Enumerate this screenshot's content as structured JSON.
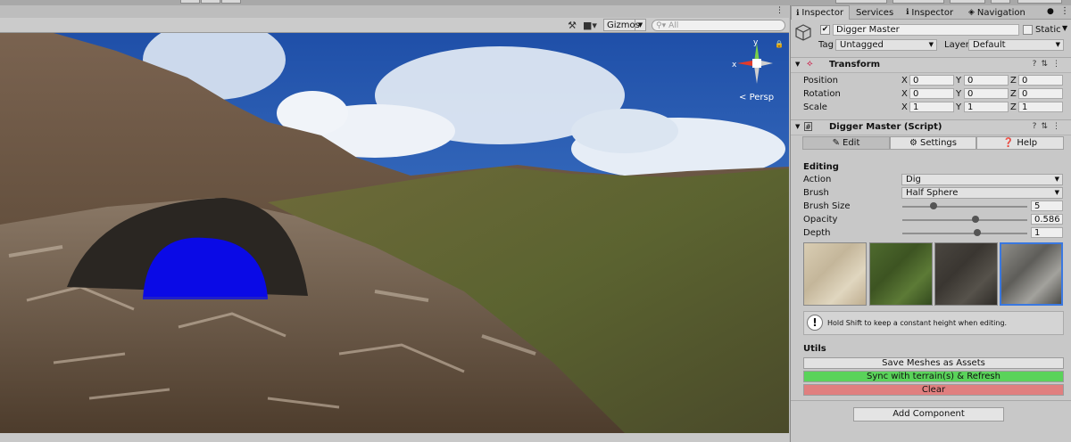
{
  "scene_toolbar": {
    "gizmos_label": "Gizmos",
    "search_placeholder": "All",
    "persp_label": "Persp",
    "axis_x": "x",
    "axis_y": "y"
  },
  "tabs": [
    {
      "label": "Inspector"
    },
    {
      "label": "Services"
    },
    {
      "label": "Inspector"
    },
    {
      "label": "Navigation"
    }
  ],
  "object": {
    "name": "Digger Master",
    "static_label": "Static",
    "tag_label": "Tag",
    "tag_value": "Untagged",
    "layer_label": "Layer",
    "layer_value": "Default"
  },
  "transform": {
    "title": "Transform",
    "rows": [
      {
        "label": "Position",
        "x": "0",
        "y": "0",
        "z": "0"
      },
      {
        "label": "Rotation",
        "x": "0",
        "y": "0",
        "z": "0"
      },
      {
        "label": "Scale",
        "x": "1",
        "y": "1",
        "z": "1"
      }
    ],
    "axis_labels": {
      "x": "X",
      "y": "Y",
      "z": "Z"
    }
  },
  "script": {
    "title": "Digger Master (Script)",
    "tool_tabs": [
      "Edit",
      "Settings",
      "Help"
    ],
    "editing_heading": "Editing",
    "action_label": "Action",
    "action_value": "Dig",
    "brush_label": "Brush",
    "brush_value": "Half Sphere",
    "brush_size_label": "Brush Size",
    "brush_size_value": "5",
    "brush_size_fraction": 0.25,
    "opacity_label": "Opacity",
    "opacity_value": "0.586",
    "opacity_fraction": 0.586,
    "depth_label": "Depth",
    "depth_value": "1",
    "depth_fraction": 0.6,
    "help_text": "Hold Shift to keep a constant height when editing.",
    "utils_heading": "Utils",
    "save_meshes_label": "Save Meshes as Assets",
    "sync_label": "Sync with terrain(s) & Refresh",
    "clear_label": "Clear",
    "add_component_label": "Add Component"
  },
  "colors": {
    "sync_button": "#5ad35a",
    "clear_button": "#e07f7f",
    "cave_fill": "#0a0ae6",
    "selected_swatch_border": "#3a78e0"
  }
}
